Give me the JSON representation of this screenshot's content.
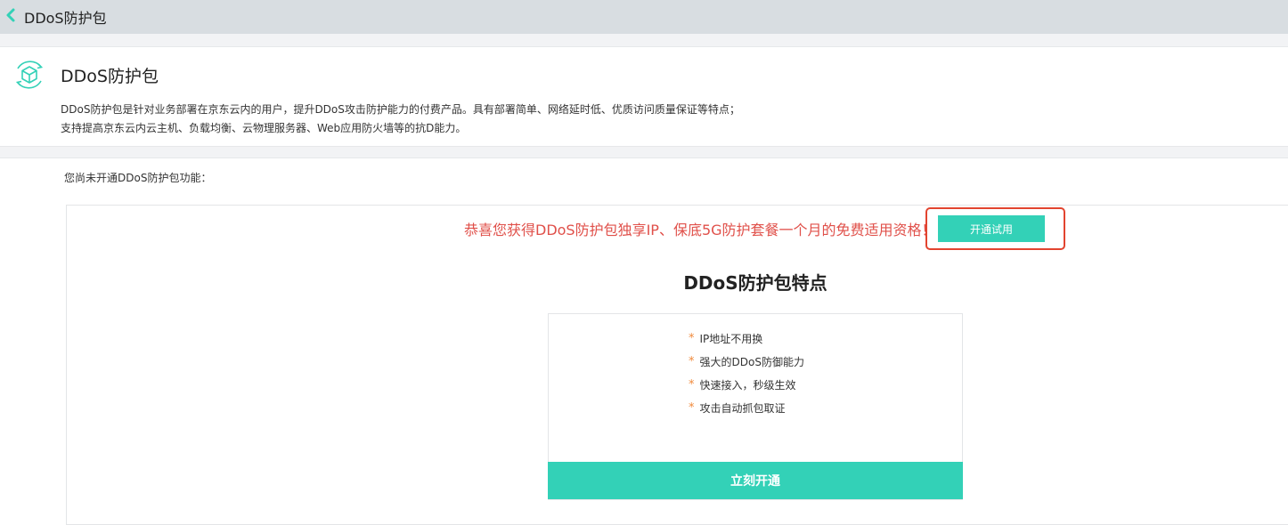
{
  "header": {
    "back_icon": "chevron-left-icon",
    "title": "DDoS防护包"
  },
  "intro": {
    "icon": "cube-refresh-icon",
    "title": "DDoS防护包",
    "desc_line1": "DDoS防护包是针对业务部署在京东云内的用户，提升DDoS攻击防护能力的付费产品。具有部署简单、网络延时低、优质访问质量保证等特点；",
    "desc_line2": "支持提高京东云内云主机、负载均衡、云物理服务器、Web应用防火墙等的抗D能力。"
  },
  "status": {
    "notice": "您尚未开通DDoS防护包功能："
  },
  "promo": {
    "text": "恭喜您获得DDoS防护包独享IP、保底5G防护套餐一个月的免费适用资格！",
    "trial_button": "开通试用"
  },
  "features": {
    "title": "DDoS防护包特点",
    "bullet": "*",
    "items": [
      "IP地址不用换",
      "强大的DDoS防御能力",
      "快速接入，秒级生效",
      "攻击自动抓包取证"
    ],
    "open_button": "立刻开通"
  },
  "colors": {
    "accent": "#33d1b7",
    "promo_text": "#e0504a",
    "highlight_border": "#e2442f",
    "bullet_star": "#f08a3c",
    "topbar_bg": "#d8dde1"
  }
}
